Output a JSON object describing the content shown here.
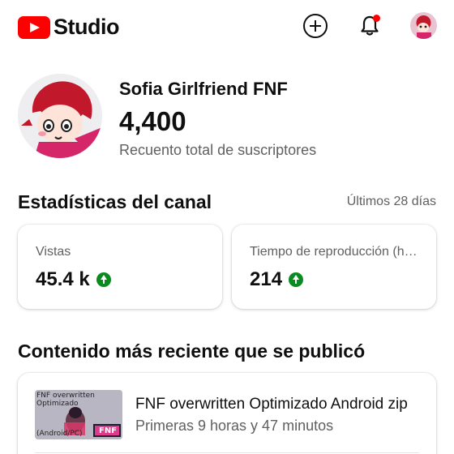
{
  "header": {
    "logo_text": "Studio",
    "icons": [
      "create-icon",
      "notifications-icon",
      "account-avatar"
    ],
    "brand_color": "#ff0000"
  },
  "channel": {
    "name": "Sofia Girlfriend FNF",
    "subscriber_count": "4,400",
    "subscriber_label": "Recuento total de suscriptores"
  },
  "stats": {
    "title": "Estadísticas del canal",
    "period": "Últimos 28 días",
    "cards": [
      {
        "label": "Vistas",
        "value": "45.4 k",
        "trend": "up"
      },
      {
        "label": "Tiempo de reproducción (horas)",
        "value": "214",
        "trend": "up"
      }
    ],
    "trend_color": "#0b8a1f"
  },
  "recent": {
    "title": "Contenido más reciente que se publicó",
    "video": {
      "title": "FNF overwritten Optimizado Android zip",
      "subtitle": "Primeras 9 horas y 47 minutos",
      "thumbnail_text": [
        "FNF overwritten",
        "Optimizado",
        "(Android/PC)"
      ],
      "thumbnail_logo": "FNF"
    }
  }
}
